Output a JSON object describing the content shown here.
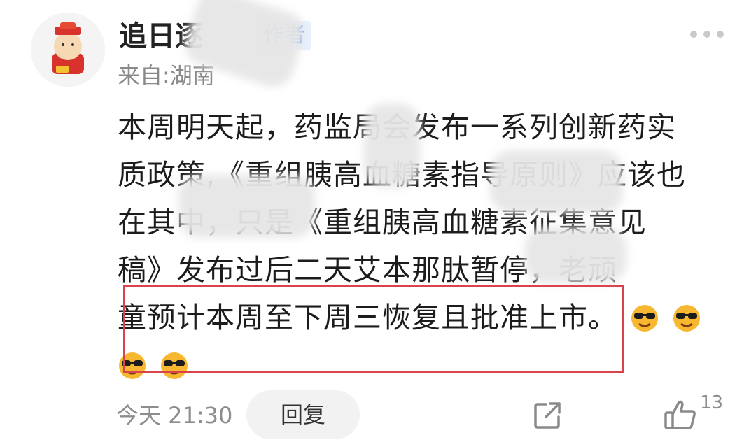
{
  "comment": {
    "username": "追日逐",
    "author_badge": "作者",
    "location": "来自:湖南",
    "lines": [
      "本周明天起，药监局会发布一系列创新药实",
      "质政策,《重组胰高血糖素指导原则》应该也",
      "在其中，只是《重组胰高血糖素征集意见",
      "稿》发布过后二天艾本那肽暂停，老顽",
      "童预计本周至下周三恢复且批准上市。"
    ],
    "emoji_name": "sunglasses-emoji",
    "emoji_count_line5": 2,
    "emoji_count_line6": 2
  },
  "footer": {
    "time": "今天 21:30",
    "reply_label": "回复",
    "like_count": "13"
  }
}
